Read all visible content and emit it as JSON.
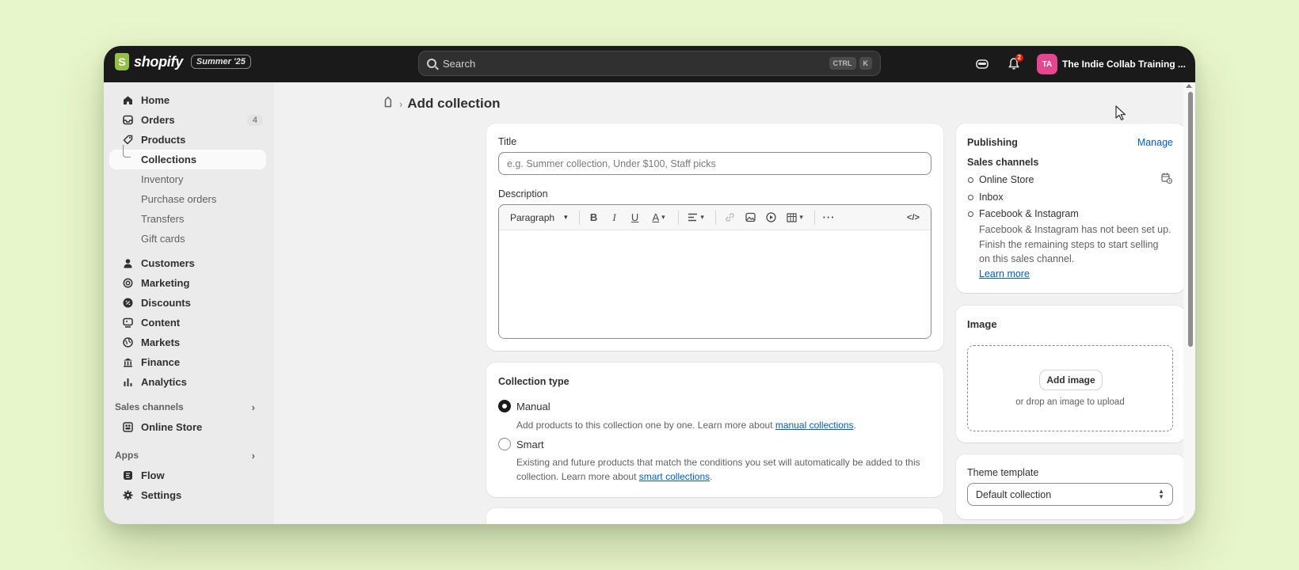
{
  "topbar": {
    "brand": "shopify",
    "edition": "Summer '25",
    "search_placeholder": "Search",
    "shortcut_ctrl": "CTRL",
    "shortcut_k": "K",
    "notification_count": "2",
    "avatar_initials": "TA",
    "store_name": "The Indie Collab Training ..."
  },
  "sidebar": {
    "home": "Home",
    "orders": "Orders",
    "orders_count": "4",
    "products": "Products",
    "collections": "Collections",
    "inventory": "Inventory",
    "purchase_orders": "Purchase orders",
    "transfers": "Transfers",
    "gift_cards": "Gift cards",
    "customers": "Customers",
    "marketing": "Marketing",
    "discounts": "Discounts",
    "content": "Content",
    "markets": "Markets",
    "finance": "Finance",
    "analytics": "Analytics",
    "sales_channels_heading": "Sales channels",
    "online_store": "Online Store",
    "apps_heading": "Apps",
    "flow": "Flow",
    "settings": "Settings"
  },
  "page": {
    "title": "Add collection"
  },
  "title_card": {
    "title_label": "Title",
    "title_placeholder": "e.g. Summer collection, Under $100, Staff picks",
    "description_label": "Description",
    "paragraph_label": "Paragraph"
  },
  "collection_type": {
    "heading": "Collection type",
    "manual_label": "Manual",
    "manual_desc": "Add products to this collection one by one. Learn more about ",
    "manual_link": "manual collections",
    "smart_label": "Smart",
    "smart_desc_line1": "Existing and future products that match the conditions you set will automatically be added to this",
    "smart_desc_line2": "collection. Learn more about ",
    "smart_link": "smart collections",
    "period": "."
  },
  "publishing": {
    "heading": "Publishing",
    "manage": "Manage",
    "sales_channels": "Sales channels",
    "channels": [
      "Online Store",
      "Inbox",
      "Facebook & Instagram"
    ],
    "fb_note_line1": "Facebook & Instagram has not been set up.",
    "fb_note_line2": "Finish the remaining steps to start selling",
    "fb_note_line3": "on this sales channel.",
    "learn_more": "Learn more"
  },
  "image_card": {
    "heading": "Image",
    "add_image": "Add image",
    "drop_hint": "or drop an image to upload"
  },
  "theme_template": {
    "label": "Theme template",
    "value": "Default collection"
  }
}
